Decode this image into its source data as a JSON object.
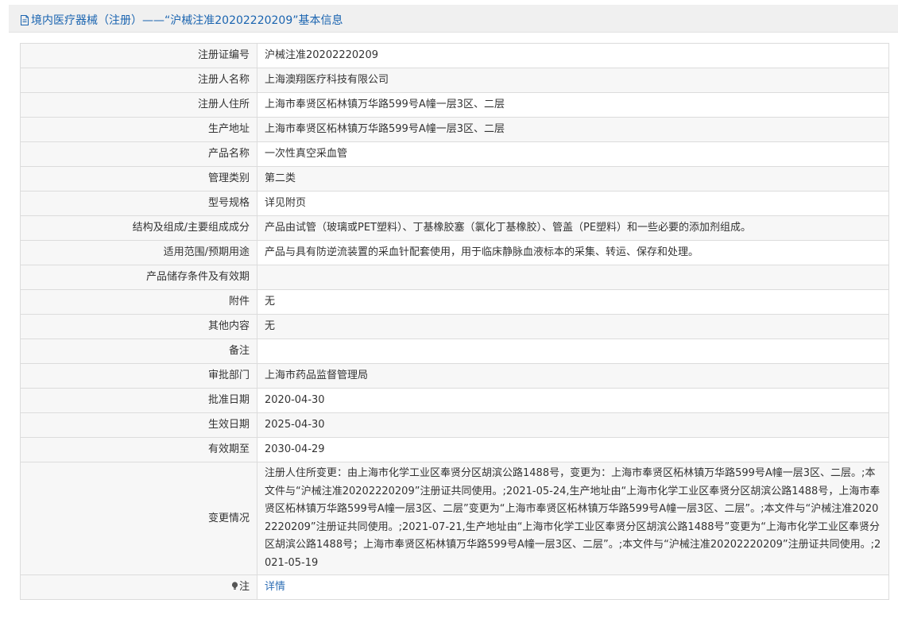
{
  "header": {
    "title": "境内医疗器械（注册）——“沪械注准20202220209”基本信息",
    "icon": "document-icon",
    "color": "#1a64b0"
  },
  "rows": [
    {
      "label": "注册证编号",
      "value": "沪械注准20202220209"
    },
    {
      "label": "注册人名称",
      "value": "上海澳翔医疗科技有限公司"
    },
    {
      "label": "注册人住所",
      "value": "上海市奉贤区柘林镇万华路599号A幢一层3区、二层"
    },
    {
      "label": "生产地址",
      "value": "上海市奉贤区柘林镇万华路599号A幢一层3区、二层"
    },
    {
      "label": "产品名称",
      "value": "一次性真空采血管"
    },
    {
      "label": "管理类别",
      "value": "第二类"
    },
    {
      "label": "型号规格",
      "value": "详见附页"
    },
    {
      "label": "结构及组成/主要组成成分",
      "value": "产品由试管（玻璃或PET塑料）、丁基橡胶塞（氯化丁基橡胶）、管盖（PE塑料）和一些必要的添加剂组成。"
    },
    {
      "label": "适用范围/预期用途",
      "value": "产品与具有防逆流装置的采血针配套使用，用于临床静脉血液标本的采集、转运、保存和处理。"
    },
    {
      "label": "产品储存条件及有效期",
      "value": ""
    },
    {
      "label": "附件",
      "value": "无"
    },
    {
      "label": "其他内容",
      "value": "无"
    },
    {
      "label": "备注",
      "value": ""
    },
    {
      "label": "审批部门",
      "value": "上海市药品监督管理局"
    },
    {
      "label": "批准日期",
      "value": "2020-04-30"
    },
    {
      "label": "生效日期",
      "value": "2025-04-30"
    },
    {
      "label": "有效期至",
      "value": "2030-04-29"
    },
    {
      "label": "变更情况",
      "value": "注册人住所变更：由上海市化学工业区奉贤分区胡滨公路1488号，变更为：上海市奉贤区柘林镇万华路599号A幢一层3区、二层。;本文件与“沪械注准20202220209”注册证共同使用。;2021-05-24,生产地址由“上海市化学工业区奉贤分区胡滨公路1488号，上海市奉贤区柘林镇万华路599号A幢一层3区、二层”变更为“上海市奉贤区柘林镇万华路599号A幢一层3区、二层”。;本文件与“沪械注准20202220209”注册证共同使用。;2021-07-21,生产地址由“上海市化学工业区奉贤分区胡滨公路1488号”变更为“上海市化学工业区奉贤分区胡滨公路1488号；上海市奉贤区柘林镇万华路599号A幢一层3区、二层”。;本文件与“沪械注准20202220209”注册证共同使用。;2021-05-19"
    }
  ],
  "note": {
    "icon": "lightbulb-icon",
    "label": "注",
    "link": "详情",
    "link_color": "#2f6fb5"
  }
}
